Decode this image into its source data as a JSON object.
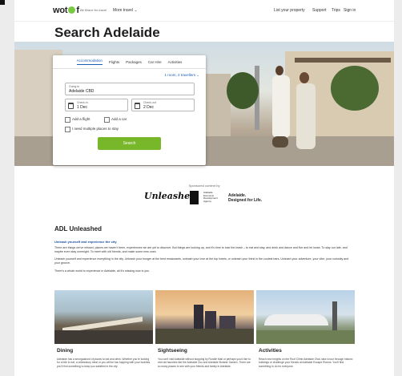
{
  "header": {
    "logo": "wotif",
    "tagline": "Be Brave for travel",
    "more_travel": "More travel",
    "nav": [
      "List your property",
      "Support",
      "Trips",
      "Sign in"
    ]
  },
  "page_title": "Search Adelaide",
  "search": {
    "tabs": [
      "Accommodation",
      "Flights",
      "Packages",
      "Car Hire",
      "Activities"
    ],
    "active_tab": "Accommodation",
    "travellers": "1 room, 2 travellers",
    "going_to_label": "Going to",
    "going_to_value": "Adelaide CBD",
    "check_in_label": "Check-in",
    "check_in_value": "1 Dec",
    "check_out_label": "Check-out",
    "check_out_value": "2 Dec",
    "add_flight": "Add a flight",
    "add_car": "Add a car",
    "multiple_places": "I need multiple places to stay",
    "button": "Search"
  },
  "sponsor": {
    "label": "Sponsored content by",
    "adl_logo": "Unleashed",
    "agency_text": [
      "Adelaide",
      "Economic",
      "Development",
      "Agency"
    ],
    "tagline": [
      "Adelaide.",
      "Designed for Life."
    ]
  },
  "article": {
    "title": "ADL Unleashed",
    "subtitle": "Unleash yourself and experience the city",
    "paragraphs": [
      "There are things we've missed, places we haven't been, experiences we are yet to discover. But things are looking up, and it's time to lose the leash – to eat and stay, and drink and dance and live and let loose. To slay our late, and maybe even stay overnight. To meet with old friends, and make some new ones.",
      "Unleash yourself and experience everything in the city. Unleash your hunger at the best restaurants, unleash your love at the top hotels, or unleash your thirst in the coolest bars. Unleash your adventure, your vibe, your curiosity and your groove.",
      "There's a whole world to experience in Adelaide, all it's missing now is you."
    ]
  },
  "cards": [
    {
      "title": "Dining",
      "text": "Adelaide has a smorgasbord of places to eat and drink. Whether you're looking for a bite to eat, a celebratory meal or you will be bar-hopping with your buddies, you'll find something to keep you satisfied in the city."
    },
    {
      "title": "Sightseeing",
      "text": "You can't visit Adelaide without stopping by Rundle Mall or perhaps you'd like to visit old favorites like the Adelaide Zoo and Adelaide Botanic Garden. There are so many places to see with your friends and family in Adelaide."
    },
    {
      "title": "Activities",
      "text": "Reach new heights on the Roof Climb Adelaide Oval, take a tour through historic buildings or challenge your friends at Adelaide Escape Rooms. You'll find something to do for everyone."
    }
  ],
  "colors": {
    "accent": "#1a5fb4",
    "search_button": "#79b72a",
    "logo_dot": "#7ac943"
  }
}
